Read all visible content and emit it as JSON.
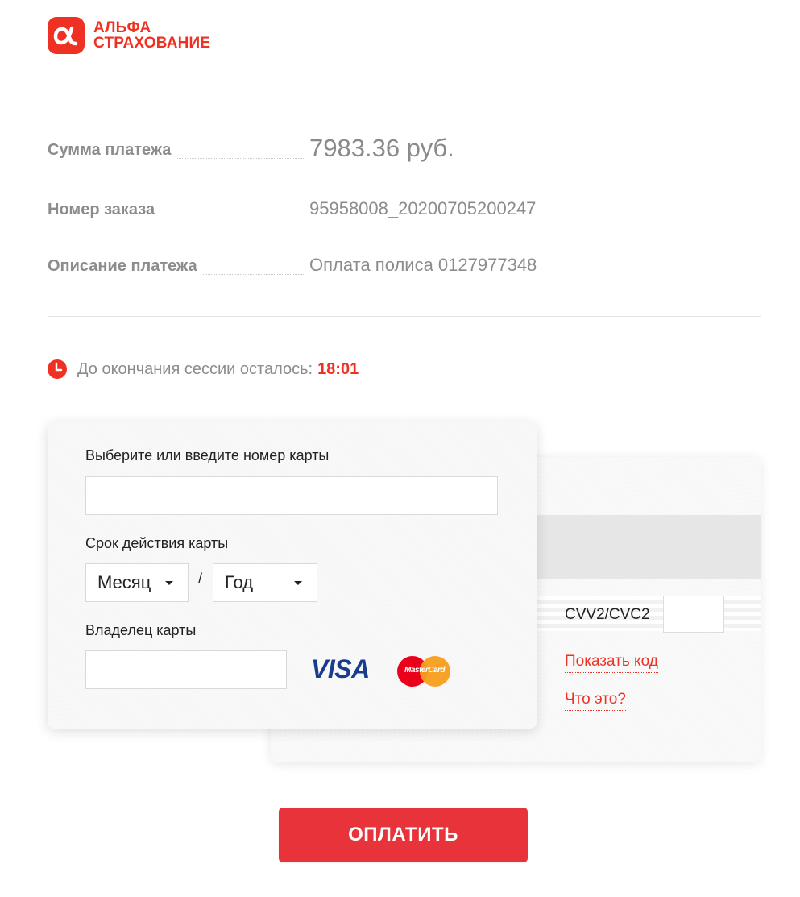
{
  "brand": {
    "logo_symbol": "α",
    "line1": "АЛЬФА",
    "line2": "СТРАХОВАНИЕ",
    "color": "#ef3124"
  },
  "payment": {
    "amount_label": "Сумма платежа",
    "amount_value": "7983.36 руб.",
    "order_label": "Номер заказа",
    "order_value": "95958008_20200705200247",
    "description_label": "Описание платежа",
    "description_value": "Оплата полиса 0127977348"
  },
  "session": {
    "text": "До окончания сессии осталось:",
    "time": "18:01",
    "icon": "clock-icon"
  },
  "card_front": {
    "card_number_label": "Выберите или введите номер карты",
    "card_number_value": "",
    "expiry_label": "Срок действия карты",
    "month_value": "Месяц",
    "separator": "/",
    "year_value": "Год",
    "holder_label": "Владелец карты",
    "holder_value": "",
    "visa_label": "VISA",
    "mastercard_label": "MasterCard"
  },
  "card_back": {
    "cvv_label": "CVV2/CVC2",
    "cvv_value": "",
    "show_code_link": "Показать код",
    "what_is_it_link": "Что это?"
  },
  "actions": {
    "pay_label": "ОПЛАТИТЬ",
    "pay_color": "#e8333a"
  }
}
